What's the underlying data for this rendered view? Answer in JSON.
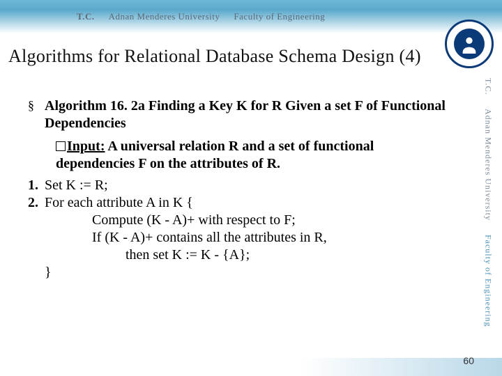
{
  "header": {
    "tc": "T.C.",
    "university": "Adnan Menderes University",
    "faculty": "Faculty of Engineering"
  },
  "title": "Algorithms for Relational Database Schema Design (4)",
  "bullet": {
    "mark": "§",
    "text": "Algorithm 16. 2a Finding a Key K for R Given a set F of Functional Dependencies"
  },
  "input_line": {
    "label": "Input:",
    "rest": " A universal relation R and a set of functional dependencies F on the attributes of R."
  },
  "steps": {
    "s1_num": "1.",
    "s1_txt": "Set K := R;",
    "s2_num": "2.",
    "s2_txt": "For each attribute A in K {",
    "s2_l1": "Compute (K - A)+ with respect to F;",
    "s2_l2": "If (K - A)+ contains all the attributes in R,",
    "s2_l3": "then set K := K - {A};",
    "close": "}"
  },
  "side": {
    "tc": "T.C.",
    "university": "Adnan Menderes University",
    "faculty": "Faculty of Engineering"
  },
  "page_number": "60"
}
